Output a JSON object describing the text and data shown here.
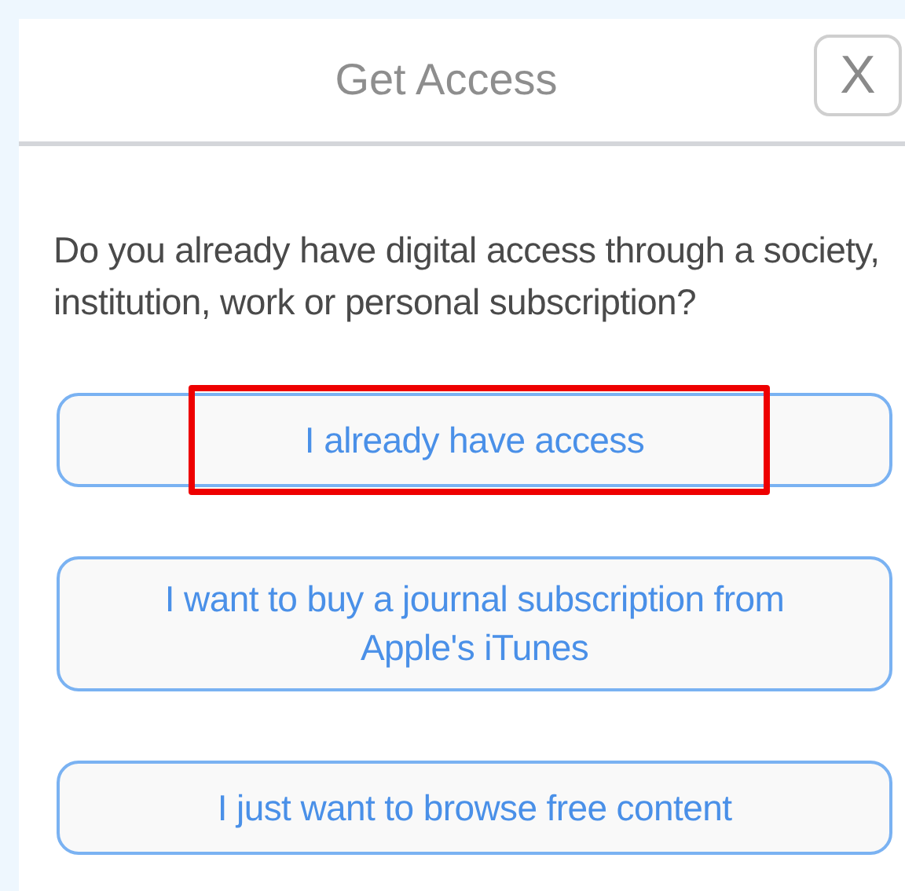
{
  "header": {
    "title": "Get Access",
    "close": "X"
  },
  "question": "Do you already have digital access through a society, institution, work or personal subscription?",
  "options": [
    {
      "label": "I already have access",
      "highlighted": true
    },
    {
      "label": "I want to buy a journal subscription from Apple's iTunes",
      "highlighted": false
    },
    {
      "label": "I just want to browse free content",
      "highlighted": false
    }
  ]
}
